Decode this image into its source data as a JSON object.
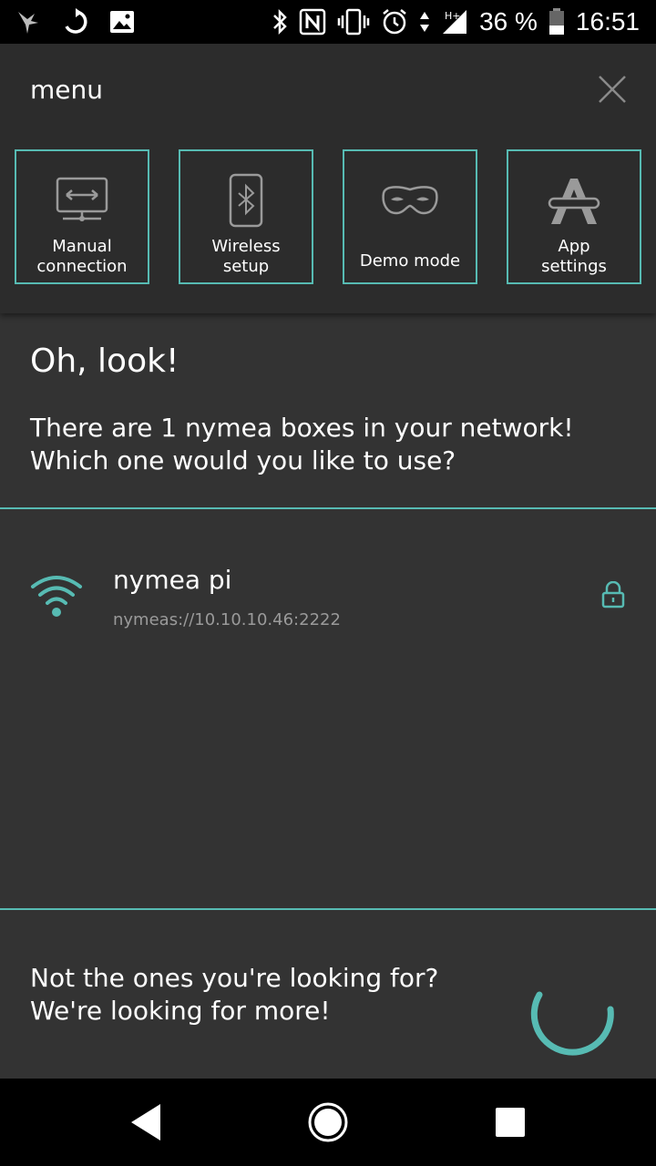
{
  "status_bar": {
    "battery_text": "36 %",
    "time": "16:51",
    "icons": [
      "bird-icon",
      "sync-icon",
      "image-icon",
      "bluetooth-icon",
      "nfc-icon",
      "vibrate-icon",
      "alarm-icon",
      "data-arrows-icon",
      "signal-icon",
      "battery-icon"
    ]
  },
  "menu": {
    "title": "menu",
    "close_icon": "close-icon",
    "tiles": [
      {
        "label": "Manual\nconnection",
        "icon": "network-icon"
      },
      {
        "label": "Wireless\nsetup",
        "icon": "bluetooth-device-icon"
      },
      {
        "label": "Demo mode",
        "icon": "mask-icon"
      },
      {
        "label": "App\nsettings",
        "icon": "app-settings-icon"
      }
    ]
  },
  "content": {
    "heading": "Oh, look!",
    "subtext": "There are 1 nymea boxes in your network! Which one would you like to use?"
  },
  "hosts": [
    {
      "name": "nymea pi",
      "url": "nymeas://10.10.10.46:2222",
      "icon": "wifi-icon",
      "secure_icon": "lock-icon"
    }
  ],
  "footer": {
    "text_line1": "Not the ones you're looking for?",
    "text_line2": "We're looking for more!"
  },
  "colors": {
    "accent": "#57bbb3",
    "background": "#333333",
    "menu_background": "#2c2c2c",
    "secondary_text": "#9a9a9a"
  }
}
